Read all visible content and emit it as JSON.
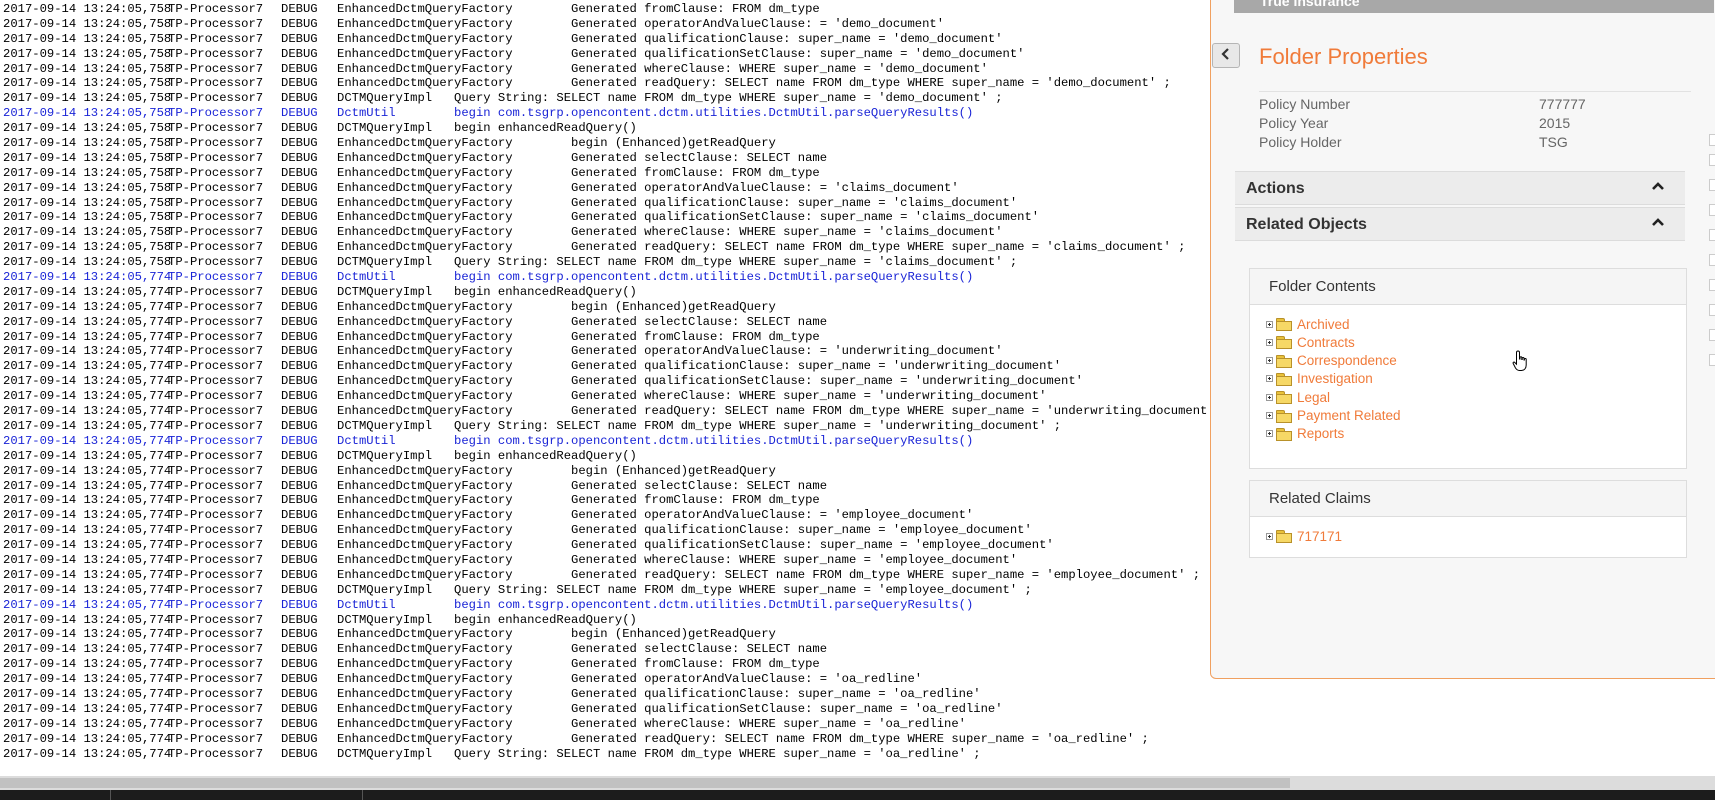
{
  "log": {
    "lines": [
      {
        "ts": "2017-09-14 13:24:05,758",
        "thread": "TP-Processor7",
        "level": "DEBUG",
        "msg": "EnhancedDctmQueryFactory        Generated fromClause: FROM dm_type",
        "blue": false
      },
      {
        "ts": "2017-09-14 13:24:05,758",
        "thread": "TP-Processor7",
        "level": "DEBUG",
        "msg": "EnhancedDctmQueryFactory        Generated operatorAndValueClause: = 'demo_document'",
        "blue": false
      },
      {
        "ts": "2017-09-14 13:24:05,758",
        "thread": "TP-Processor7",
        "level": "DEBUG",
        "msg": "EnhancedDctmQueryFactory        Generated qualificationClause: super_name = 'demo_document'",
        "blue": false
      },
      {
        "ts": "2017-09-14 13:24:05,758",
        "thread": "TP-Processor7",
        "level": "DEBUG",
        "msg": "EnhancedDctmQueryFactory        Generated qualificationSetClause: super_name = 'demo_document'",
        "blue": false
      },
      {
        "ts": "2017-09-14 13:24:05,758",
        "thread": "TP-Processor7",
        "level": "DEBUG",
        "msg": "EnhancedDctmQueryFactory        Generated whereClause: WHERE super_name = 'demo_document'",
        "blue": false
      },
      {
        "ts": "2017-09-14 13:24:05,758",
        "thread": "TP-Processor7",
        "level": "DEBUG",
        "msg": "EnhancedDctmQueryFactory        Generated readQuery: SELECT name FROM dm_type WHERE super_name = 'demo_document' ;",
        "blue": false
      },
      {
        "ts": "2017-09-14 13:24:05,758",
        "thread": "TP-Processor7",
        "level": "DEBUG",
        "msg": "DCTMQueryImpl   Query String: SELECT name FROM dm_type WHERE super_name = 'demo_document' ;",
        "blue": false
      },
      {
        "ts": "2017-09-14 13:24:05,758",
        "thread": "TP-Processor7",
        "level": "DEBUG",
        "msg": "DctmUtil        begin com.tsgrp.opencontent.dctm.utilities.DctmUtil.parseQueryResults()",
        "blue": true
      },
      {
        "ts": "2017-09-14 13:24:05,758",
        "thread": "TP-Processor7",
        "level": "DEBUG",
        "msg": "DCTMQueryImpl   begin enhancedReadQuery()",
        "blue": false
      },
      {
        "ts": "2017-09-14 13:24:05,758",
        "thread": "TP-Processor7",
        "level": "DEBUG",
        "msg": "EnhancedDctmQueryFactory        begin (Enhanced)getReadQuery",
        "blue": false
      },
      {
        "ts": "2017-09-14 13:24:05,758",
        "thread": "TP-Processor7",
        "level": "DEBUG",
        "msg": "EnhancedDctmQueryFactory        Generated selectClause: SELECT name",
        "blue": false
      },
      {
        "ts": "2017-09-14 13:24:05,758",
        "thread": "TP-Processor7",
        "level": "DEBUG",
        "msg": "EnhancedDctmQueryFactory        Generated fromClause: FROM dm_type",
        "blue": false
      },
      {
        "ts": "2017-09-14 13:24:05,758",
        "thread": "TP-Processor7",
        "level": "DEBUG",
        "msg": "EnhancedDctmQueryFactory        Generated operatorAndValueClause: = 'claims_document'",
        "blue": false
      },
      {
        "ts": "2017-09-14 13:24:05,758",
        "thread": "TP-Processor7",
        "level": "DEBUG",
        "msg": "EnhancedDctmQueryFactory        Generated qualificationClause: super_name = 'claims_document'",
        "blue": false
      },
      {
        "ts": "2017-09-14 13:24:05,758",
        "thread": "TP-Processor7",
        "level": "DEBUG",
        "msg": "EnhancedDctmQueryFactory        Generated qualificationSetClause: super_name = 'claims_document'",
        "blue": false
      },
      {
        "ts": "2017-09-14 13:24:05,758",
        "thread": "TP-Processor7",
        "level": "DEBUG",
        "msg": "EnhancedDctmQueryFactory        Generated whereClause: WHERE super_name = 'claims_document'",
        "blue": false
      },
      {
        "ts": "2017-09-14 13:24:05,758",
        "thread": "TP-Processor7",
        "level": "DEBUG",
        "msg": "EnhancedDctmQueryFactory        Generated readQuery: SELECT name FROM dm_type WHERE super_name = 'claims_document' ;",
        "blue": false
      },
      {
        "ts": "2017-09-14 13:24:05,758",
        "thread": "TP-Processor7",
        "level": "DEBUG",
        "msg": "DCTMQueryImpl   Query String: SELECT name FROM dm_type WHERE super_name = 'claims_document' ;",
        "blue": false
      },
      {
        "ts": "2017-09-14 13:24:05,774",
        "thread": "TP-Processor7",
        "level": "DEBUG",
        "msg": "DctmUtil        begin com.tsgrp.opencontent.dctm.utilities.DctmUtil.parseQueryResults()",
        "blue": true
      },
      {
        "ts": "2017-09-14 13:24:05,774",
        "thread": "TP-Processor7",
        "level": "DEBUG",
        "msg": "DCTMQueryImpl   begin enhancedReadQuery()",
        "blue": false
      },
      {
        "ts": "2017-09-14 13:24:05,774",
        "thread": "TP-Processor7",
        "level": "DEBUG",
        "msg": "EnhancedDctmQueryFactory        begin (Enhanced)getReadQuery",
        "blue": false
      },
      {
        "ts": "2017-09-14 13:24:05,774",
        "thread": "TP-Processor7",
        "level": "DEBUG",
        "msg": "EnhancedDctmQueryFactory        Generated selectClause: SELECT name",
        "blue": false
      },
      {
        "ts": "2017-09-14 13:24:05,774",
        "thread": "TP-Processor7",
        "level": "DEBUG",
        "msg": "EnhancedDctmQueryFactory        Generated fromClause: FROM dm_type",
        "blue": false
      },
      {
        "ts": "2017-09-14 13:24:05,774",
        "thread": "TP-Processor7",
        "level": "DEBUG",
        "msg": "EnhancedDctmQueryFactory        Generated operatorAndValueClause: = 'underwriting_document'",
        "blue": false
      },
      {
        "ts": "2017-09-14 13:24:05,774",
        "thread": "TP-Processor7",
        "level": "DEBUG",
        "msg": "EnhancedDctmQueryFactory        Generated qualificationClause: super_name = 'underwriting_document'",
        "blue": false
      },
      {
        "ts": "2017-09-14 13:24:05,774",
        "thread": "TP-Processor7",
        "level": "DEBUG",
        "msg": "EnhancedDctmQueryFactory        Generated qualificationSetClause: super_name = 'underwriting_document'",
        "blue": false
      },
      {
        "ts": "2017-09-14 13:24:05,774",
        "thread": "TP-Processor7",
        "level": "DEBUG",
        "msg": "EnhancedDctmQueryFactory        Generated whereClause: WHERE super_name = 'underwriting_document'",
        "blue": false
      },
      {
        "ts": "2017-09-14 13:24:05,774",
        "thread": "TP-Processor7",
        "level": "DEBUG",
        "msg": "EnhancedDctmQueryFactory        Generated readQuery: SELECT name FROM dm_type WHERE super_name = 'underwriting_document' ;",
        "blue": false
      },
      {
        "ts": "2017-09-14 13:24:05,774",
        "thread": "TP-Processor7",
        "level": "DEBUG",
        "msg": "DCTMQueryImpl   Query String: SELECT name FROM dm_type WHERE super_name = 'underwriting_document' ;",
        "blue": false
      },
      {
        "ts": "2017-09-14 13:24:05,774",
        "thread": "TP-Processor7",
        "level": "DEBUG",
        "msg": "DctmUtil        begin com.tsgrp.opencontent.dctm.utilities.DctmUtil.parseQueryResults()",
        "blue": true
      },
      {
        "ts": "2017-09-14 13:24:05,774",
        "thread": "TP-Processor7",
        "level": "DEBUG",
        "msg": "DCTMQueryImpl   begin enhancedReadQuery()",
        "blue": false
      },
      {
        "ts": "2017-09-14 13:24:05,774",
        "thread": "TP-Processor7",
        "level": "DEBUG",
        "msg": "EnhancedDctmQueryFactory        begin (Enhanced)getReadQuery",
        "blue": false
      },
      {
        "ts": "2017-09-14 13:24:05,774",
        "thread": "TP-Processor7",
        "level": "DEBUG",
        "msg": "EnhancedDctmQueryFactory        Generated selectClause: SELECT name",
        "blue": false
      },
      {
        "ts": "2017-09-14 13:24:05,774",
        "thread": "TP-Processor7",
        "level": "DEBUG",
        "msg": "EnhancedDctmQueryFactory        Generated fromClause: FROM dm_type",
        "blue": false
      },
      {
        "ts": "2017-09-14 13:24:05,774",
        "thread": "TP-Processor7",
        "level": "DEBUG",
        "msg": "EnhancedDctmQueryFactory        Generated operatorAndValueClause: = 'employee_document'",
        "blue": false
      },
      {
        "ts": "2017-09-14 13:24:05,774",
        "thread": "TP-Processor7",
        "level": "DEBUG",
        "msg": "EnhancedDctmQueryFactory        Generated qualificationClause: super_name = 'employee_document'",
        "blue": false
      },
      {
        "ts": "2017-09-14 13:24:05,774",
        "thread": "TP-Processor7",
        "level": "DEBUG",
        "msg": "EnhancedDctmQueryFactory        Generated qualificationSetClause: super_name = 'employee_document'",
        "blue": false
      },
      {
        "ts": "2017-09-14 13:24:05,774",
        "thread": "TP-Processor7",
        "level": "DEBUG",
        "msg": "EnhancedDctmQueryFactory        Generated whereClause: WHERE super_name = 'employee_document'",
        "blue": false
      },
      {
        "ts": "2017-09-14 13:24:05,774",
        "thread": "TP-Processor7",
        "level": "DEBUG",
        "msg": "EnhancedDctmQueryFactory        Generated readQuery: SELECT name FROM dm_type WHERE super_name = 'employee_document' ;",
        "blue": false
      },
      {
        "ts": "2017-09-14 13:24:05,774",
        "thread": "TP-Processor7",
        "level": "DEBUG",
        "msg": "DCTMQueryImpl   Query String: SELECT name FROM dm_type WHERE super_name = 'employee_document' ;",
        "blue": false
      },
      {
        "ts": "2017-09-14 13:24:05,774",
        "thread": "TP-Processor7",
        "level": "DEBUG",
        "msg": "DctmUtil        begin com.tsgrp.opencontent.dctm.utilities.DctmUtil.parseQueryResults()",
        "blue": true
      },
      {
        "ts": "2017-09-14 13:24:05,774",
        "thread": "TP-Processor7",
        "level": "DEBUG",
        "msg": "DCTMQueryImpl   begin enhancedReadQuery()",
        "blue": false
      },
      {
        "ts": "2017-09-14 13:24:05,774",
        "thread": "TP-Processor7",
        "level": "DEBUG",
        "msg": "EnhancedDctmQueryFactory        begin (Enhanced)getReadQuery",
        "blue": false
      },
      {
        "ts": "2017-09-14 13:24:05,774",
        "thread": "TP-Processor7",
        "level": "DEBUG",
        "msg": "EnhancedDctmQueryFactory        Generated selectClause: SELECT name",
        "blue": false
      },
      {
        "ts": "2017-09-14 13:24:05,774",
        "thread": "TP-Processor7",
        "level": "DEBUG",
        "msg": "EnhancedDctmQueryFactory        Generated fromClause: FROM dm_type",
        "blue": false
      },
      {
        "ts": "2017-09-14 13:24:05,774",
        "thread": "TP-Processor7",
        "level": "DEBUG",
        "msg": "EnhancedDctmQueryFactory        Generated operatorAndValueClause: = 'oa_redline'",
        "blue": false
      },
      {
        "ts": "2017-09-14 13:24:05,774",
        "thread": "TP-Processor7",
        "level": "DEBUG",
        "msg": "EnhancedDctmQueryFactory        Generated qualificationClause: super_name = 'oa_redline'",
        "blue": false
      },
      {
        "ts": "2017-09-14 13:24:05,774",
        "thread": "TP-Processor7",
        "level": "DEBUG",
        "msg": "EnhancedDctmQueryFactory        Generated qualificationSetClause: super_name = 'oa_redline'",
        "blue": false
      },
      {
        "ts": "2017-09-14 13:24:05,774",
        "thread": "TP-Processor7",
        "level": "DEBUG",
        "msg": "EnhancedDctmQueryFactory        Generated whereClause: WHERE super_name = 'oa_redline'",
        "blue": false
      },
      {
        "ts": "2017-09-14 13:24:05,774",
        "thread": "TP-Processor7",
        "level": "DEBUG",
        "msg": "EnhancedDctmQueryFactory        Generated readQuery: SELECT name FROM dm_type WHERE super_name = 'oa_redline' ;",
        "blue": false
      },
      {
        "ts": "2017-09-14 13:24:05,774",
        "thread": "TP-Processor7",
        "level": "DEBUG",
        "msg": "DCTMQueryImpl   Query String: SELECT name FROM dm_type WHERE super_name = 'oa_redline' ;",
        "blue": false
      }
    ]
  },
  "panel": {
    "header_title": "True Insurance",
    "collapse_icon": "chevron-left-icon",
    "properties": {
      "title": "Folder Properties",
      "rows": [
        {
          "key": "Policy Number",
          "value": "777777"
        },
        {
          "key": "Policy Year",
          "value": "2015"
        },
        {
          "key": "Policy Holder",
          "value": "TSG"
        }
      ]
    },
    "accordions": [
      {
        "label": "Actions",
        "icon": "chevron-up-icon"
      },
      {
        "label": "Related Objects",
        "icon": "chevron-up-icon"
      }
    ],
    "folder_contents": {
      "title": "Folder Contents",
      "items": [
        "Archived",
        "Contracts",
        "Correspondence",
        "Investigation",
        "Legal",
        "Payment Related",
        "Reports"
      ]
    },
    "related_claims": {
      "title": "Related Claims",
      "items": [
        "717171"
      ]
    }
  },
  "colors": {
    "accent": "#f07b3a",
    "log_highlight": "#1a24d6",
    "panel_border": "#f0a060"
  }
}
